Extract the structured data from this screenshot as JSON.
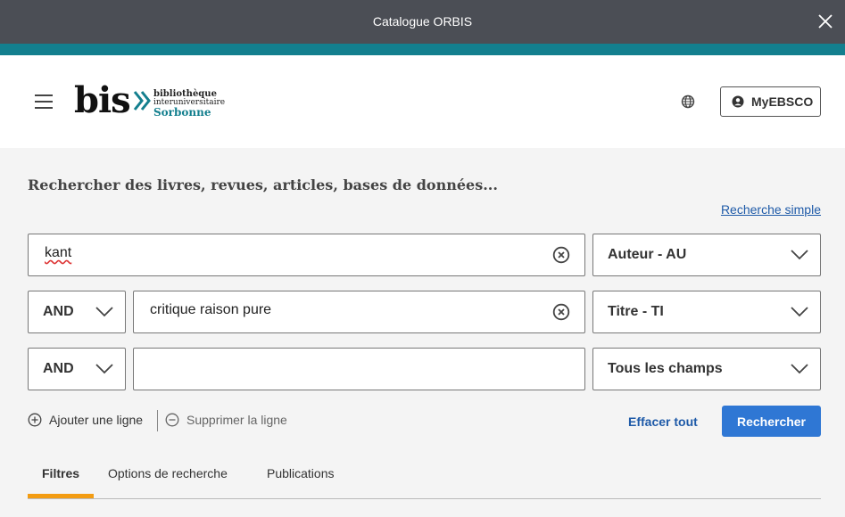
{
  "window": {
    "title": "Catalogue ORBIS"
  },
  "header": {
    "logo": {
      "main": "bis",
      "line1": "bibliothèque",
      "line2": "interuniversitaire",
      "line3": "Sorbonne"
    },
    "account_label": "MyEBSCO"
  },
  "search": {
    "heading": "Rechercher des livres, revues, articles, bases de données...",
    "simple_search_link": "Recherche simple",
    "rows": [
      {
        "operator": "",
        "value": "kant",
        "field": "Auteur - AU"
      },
      {
        "operator": "AND",
        "value": "critique raison pure",
        "field": "Titre - TI"
      },
      {
        "operator": "AND",
        "value": "",
        "field": "Tous les champs"
      }
    ],
    "add_line": "Ajouter une ligne",
    "remove_line": "Supprimer la ligne",
    "clear_all": "Effacer tout",
    "submit": "Rechercher"
  },
  "tabs": [
    {
      "label": "Filtres",
      "active": true
    },
    {
      "label": "Options de recherche",
      "active": false
    },
    {
      "label": "Publications",
      "active": false
    }
  ],
  "colors": {
    "teal": "#137f8e",
    "link": "#1e5aa8",
    "primary": "#2f77d4",
    "accent": "#f39c12"
  }
}
